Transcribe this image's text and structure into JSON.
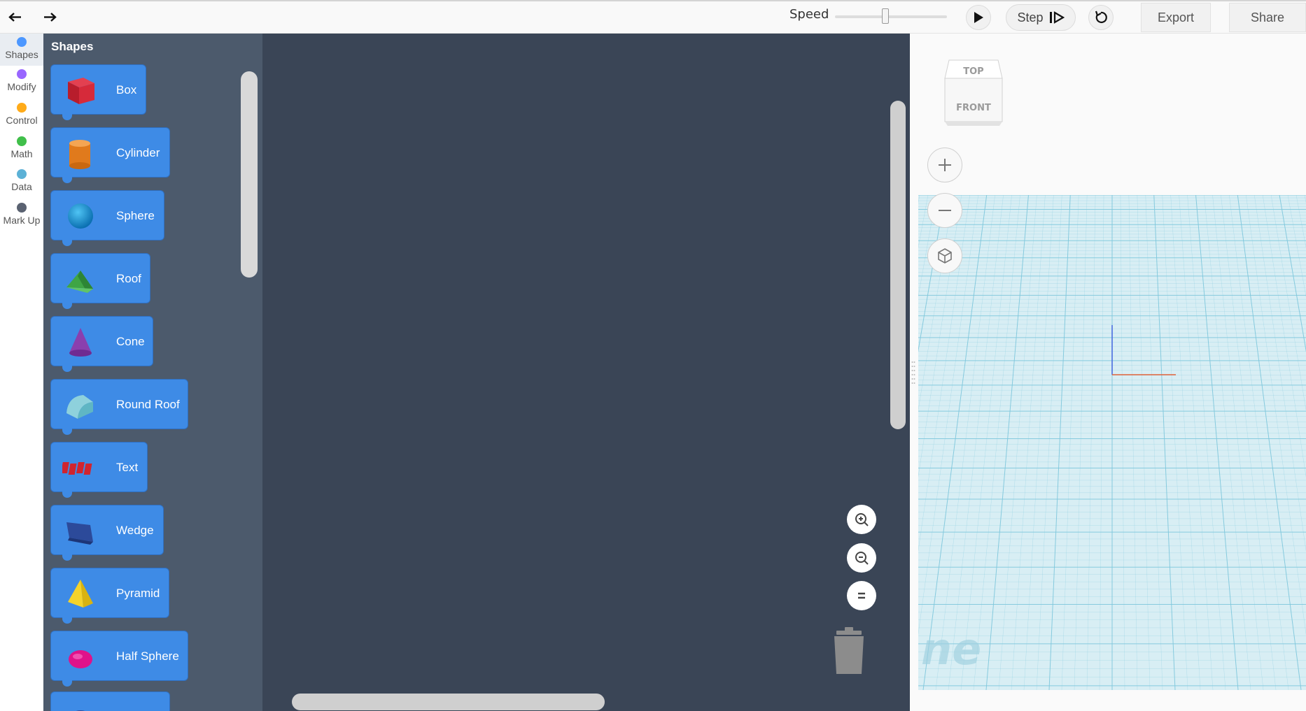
{
  "toolbar": {
    "undo_icon": "undo-arrow-icon",
    "redo_icon": "redo-arrow-icon",
    "speed_label": "Speed",
    "speed_value": 0.45,
    "play_icon": "play-icon",
    "step_label": "Step",
    "step_icon": "step-forward-icon",
    "reset_icon": "reset-icon",
    "export_label": "Export",
    "share_label": "Share"
  },
  "categories": [
    {
      "label": "Shapes",
      "color": "#4c97ff",
      "active": true
    },
    {
      "label": "Modify",
      "color": "#9966ff",
      "active": false
    },
    {
      "label": "Control",
      "color": "#ffab19",
      "active": false
    },
    {
      "label": "Math",
      "color": "#40bf4a",
      "active": false
    },
    {
      "label": "Data",
      "color": "#5cb1d6",
      "active": false
    },
    {
      "label": "Mark Up",
      "color": "#5a6271",
      "active": false
    }
  ],
  "palette": {
    "title": "Shapes",
    "blocks": [
      {
        "label": "Box",
        "icon": "box-shape-icon"
      },
      {
        "label": "Cylinder",
        "icon": "cylinder-shape-icon"
      },
      {
        "label": "Sphere",
        "icon": "sphere-shape-icon"
      },
      {
        "label": "Roof",
        "icon": "roof-shape-icon"
      },
      {
        "label": "Cone",
        "icon": "cone-shape-icon"
      },
      {
        "label": "Round Roof",
        "icon": "round-roof-shape-icon"
      },
      {
        "label": "Text",
        "icon": "text-shape-icon"
      },
      {
        "label": "Wedge",
        "icon": "wedge-shape-icon"
      },
      {
        "label": "Pyramid",
        "icon": "pyramid-shape-icon"
      },
      {
        "label": "Half Sphere",
        "icon": "half-sphere-shape-icon"
      }
    ]
  },
  "workspace": {
    "zoom_in_icon": "zoom-in-icon",
    "zoom_out_icon": "zoom-out-icon",
    "zoom_reset_icon": "zoom-reset-icon",
    "trash_icon": "trash-icon"
  },
  "viewport": {
    "navcube_top": "TOP",
    "navcube_front": "FRONT",
    "zoom_in_icon": "plus-icon",
    "zoom_out_icon": "minus-icon",
    "home_view_icon": "home-view-cube-icon",
    "watermark": "ne",
    "grid_color": "#7ec7dc",
    "accent": "#3e8be6"
  }
}
